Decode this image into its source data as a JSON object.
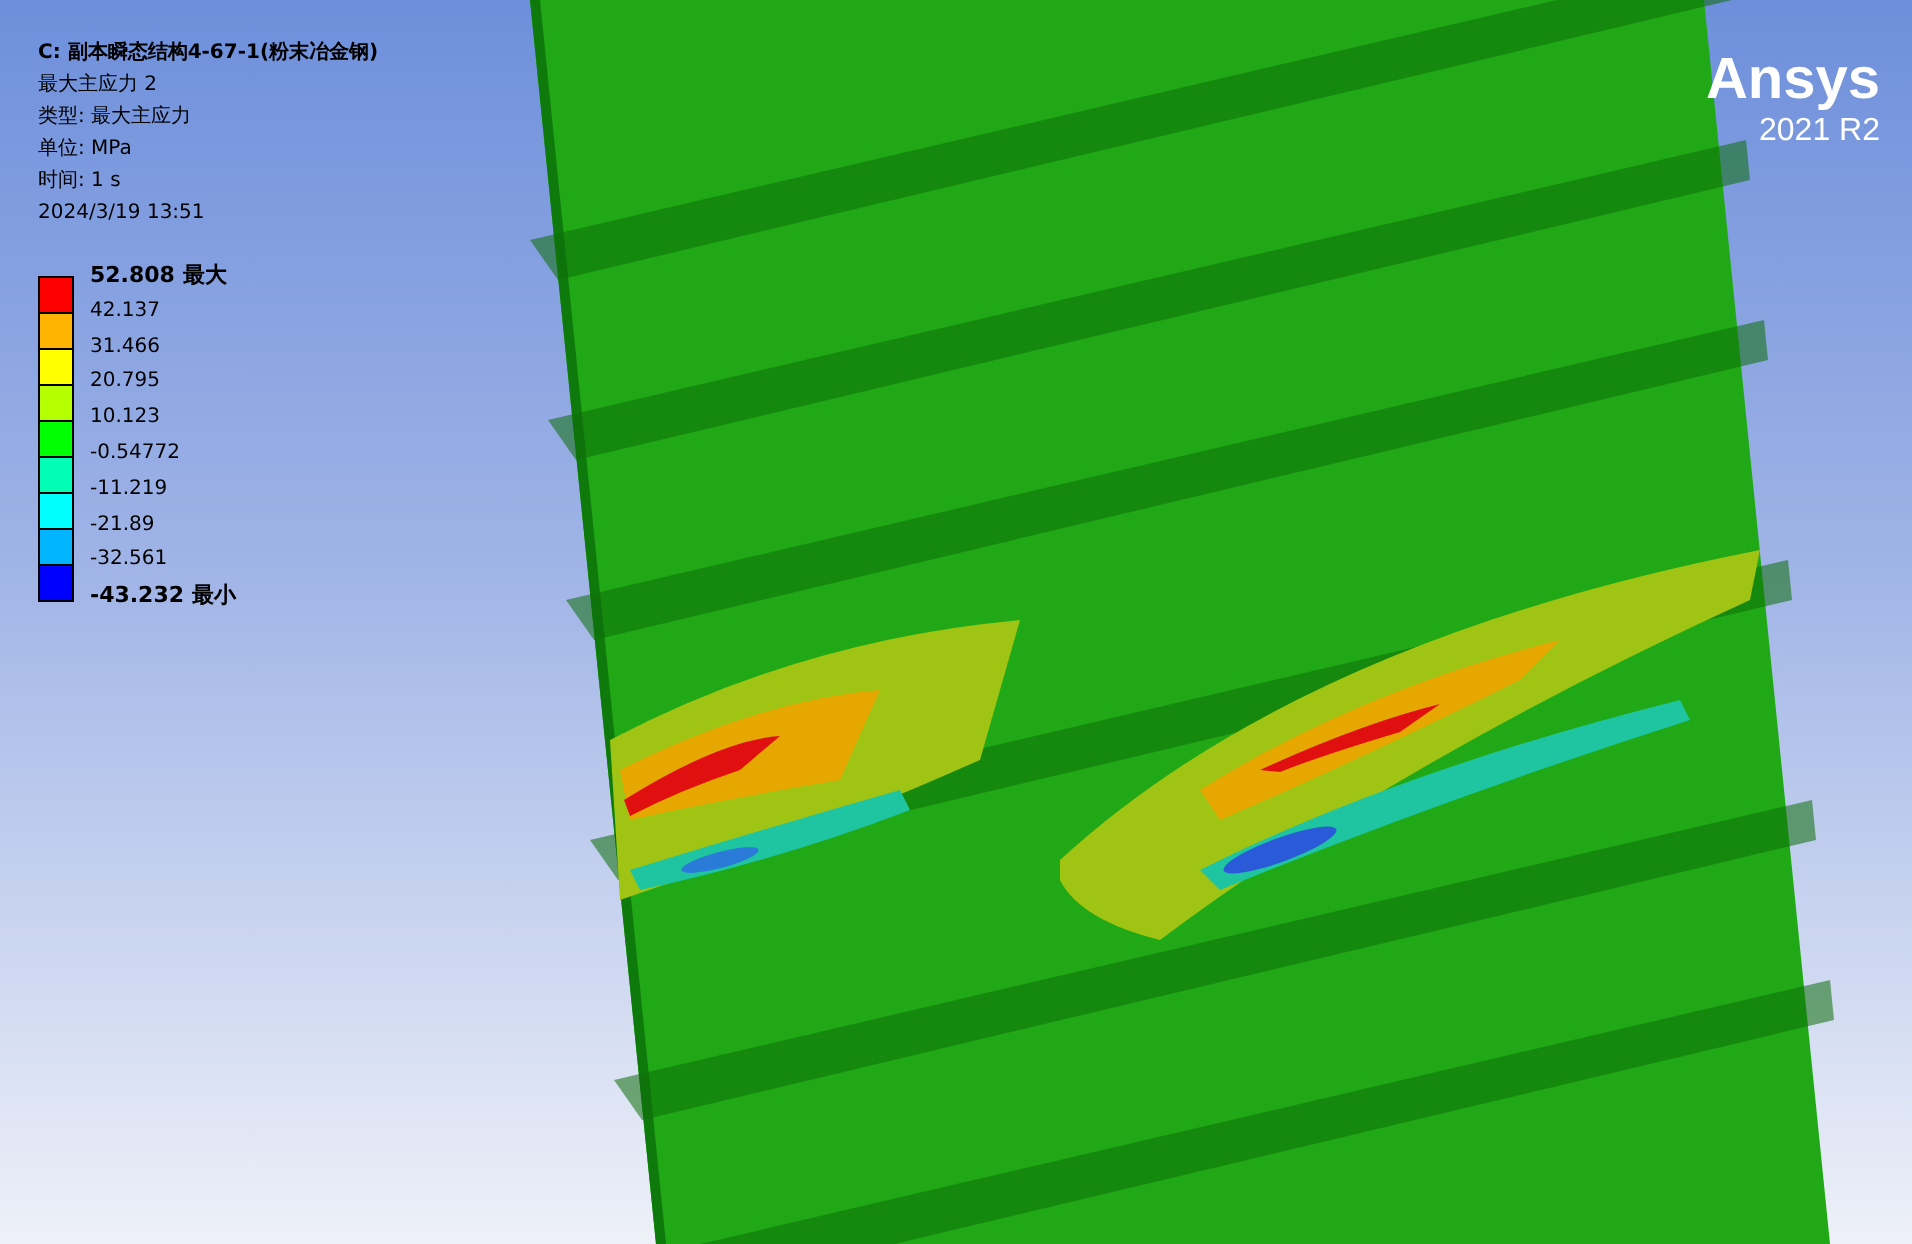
{
  "header": {
    "title": "C: 副本瞬态结构4-67-1(粉末冶金钢)",
    "lines": [
      "最大主应力 2",
      "类型: 最大主应力",
      "单位: MPa",
      "时间: 1 s",
      "2024/3/19 13:51"
    ]
  },
  "legend": {
    "bands": [
      {
        "color": "#ff0000"
      },
      {
        "color": "#ffb400"
      },
      {
        "color": "#ffff00"
      },
      {
        "color": "#b4ff00"
      },
      {
        "color": "#00ff00"
      },
      {
        "color": "#00ffb4"
      },
      {
        "color": "#00ffff"
      },
      {
        "color": "#00b4ff"
      },
      {
        "color": "#0000ff"
      }
    ],
    "labels": [
      {
        "kind": "max",
        "value": "52.808",
        "suffix": "最大"
      },
      {
        "kind": "normal",
        "value": "42.137"
      },
      {
        "kind": "normal",
        "value": "31.466"
      },
      {
        "kind": "normal",
        "value": "20.795"
      },
      {
        "kind": "normal",
        "value": "10.123"
      },
      {
        "kind": "normal",
        "value": "-0.54772"
      },
      {
        "kind": "normal",
        "value": "-11.219"
      },
      {
        "kind": "normal",
        "value": "-21.89"
      },
      {
        "kind": "normal",
        "value": "-32.561"
      },
      {
        "kind": "min",
        "value": "-43.232",
        "suffix": "最小"
      }
    ]
  },
  "logo": {
    "brand": "Ansys",
    "version": "2021 R2"
  }
}
